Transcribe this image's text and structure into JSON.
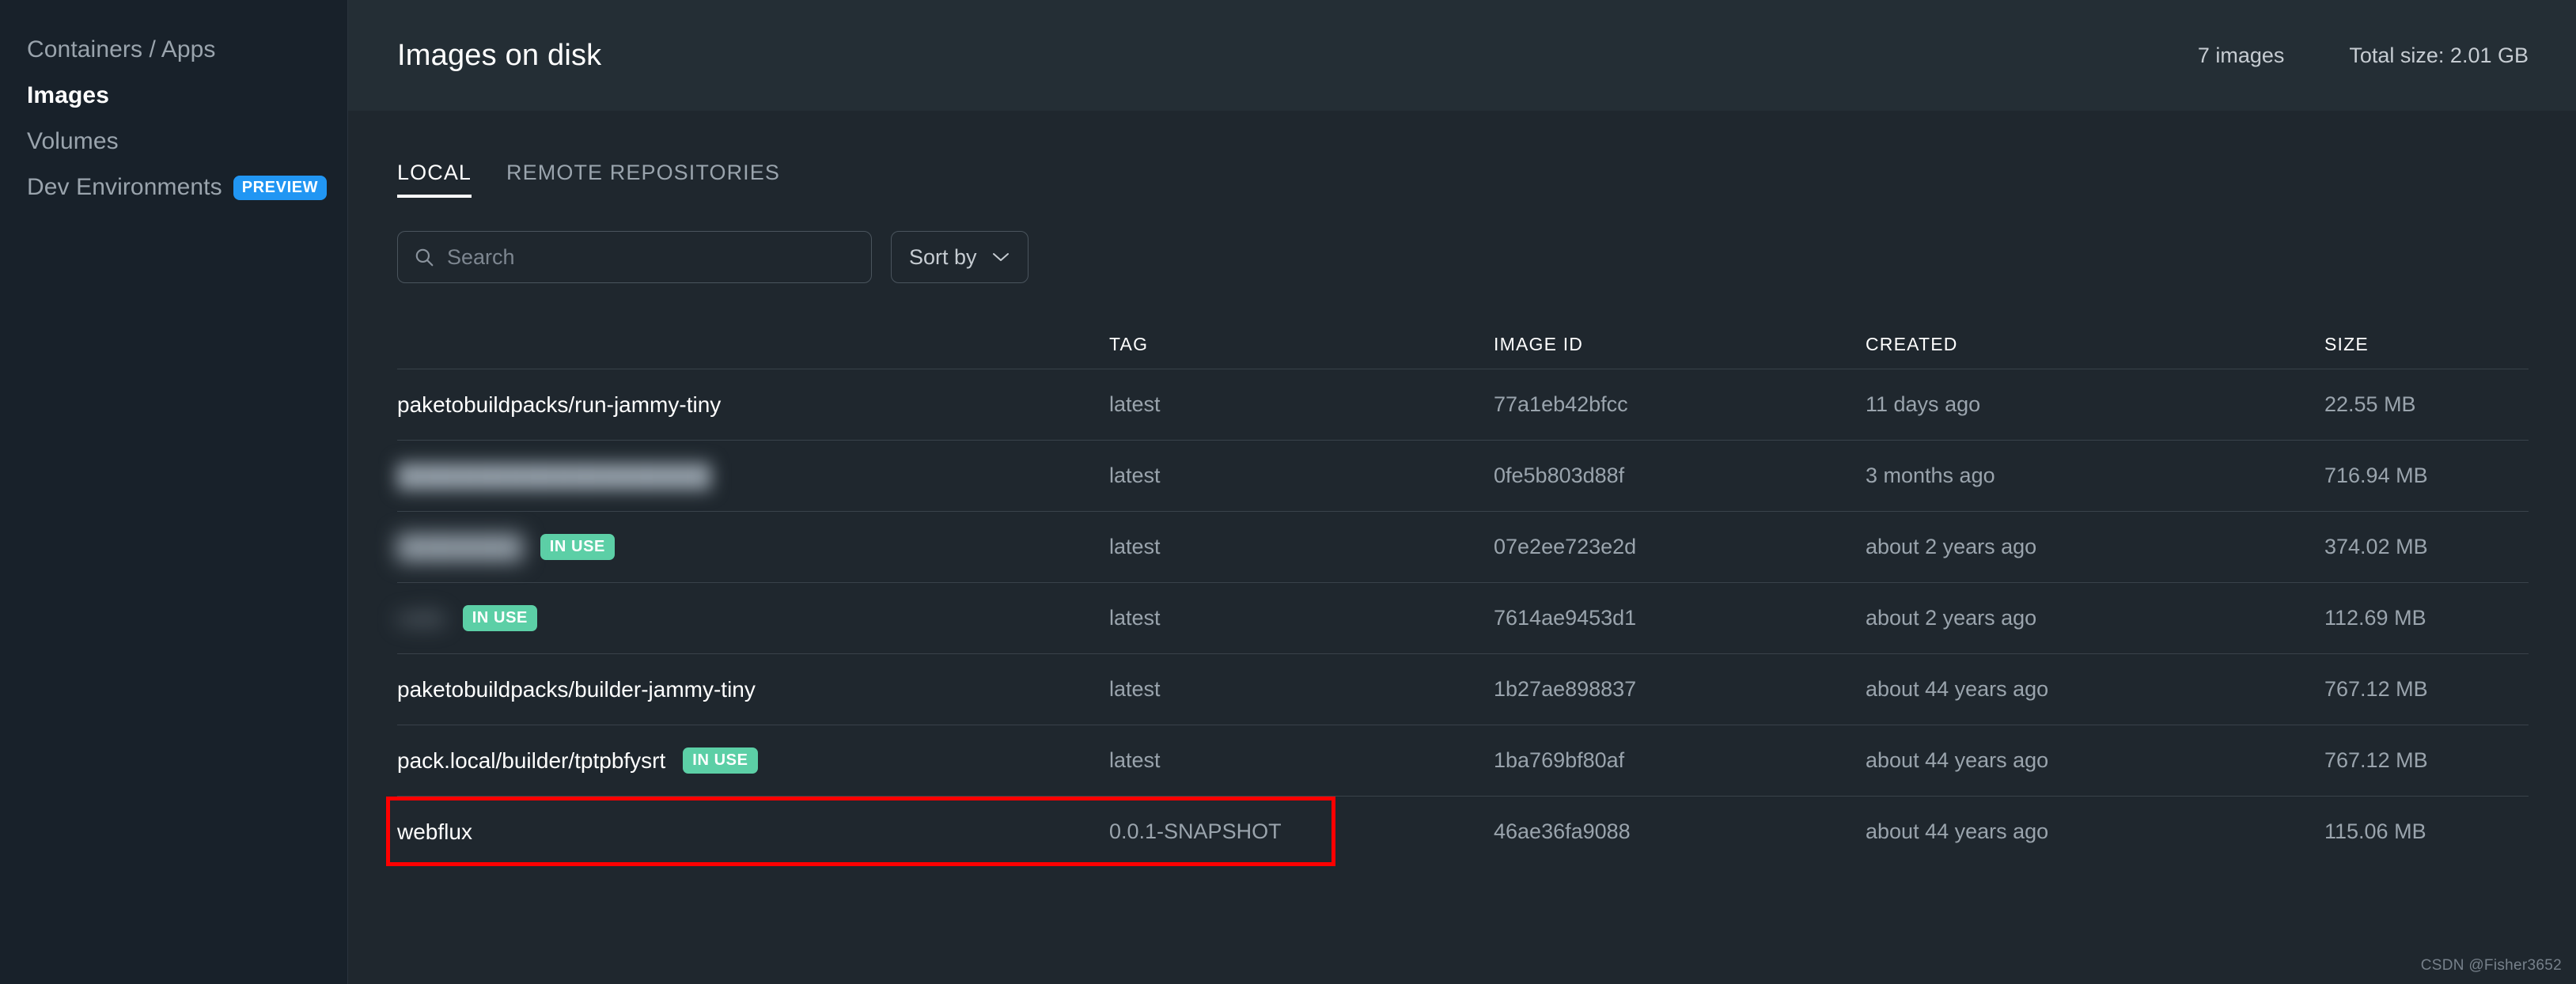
{
  "sidebar": {
    "items": [
      {
        "label": "Containers / Apps",
        "active": false,
        "badge": null
      },
      {
        "label": "Images",
        "active": true,
        "badge": null
      },
      {
        "label": "Volumes",
        "active": false,
        "badge": null
      },
      {
        "label": "Dev Environments",
        "active": false,
        "badge": "PREVIEW"
      }
    ]
  },
  "header": {
    "title": "Images on disk",
    "image_count": "7 images",
    "total_size": "Total size: 2.01 GB"
  },
  "tabs": [
    {
      "label": "LOCAL",
      "active": true
    },
    {
      "label": "REMOTE REPOSITORIES",
      "active": false
    }
  ],
  "toolbar": {
    "search_placeholder": "Search",
    "search_value": "",
    "search_icon": "search-icon",
    "sort_label": "Sort by",
    "sort_icon": "chevron-down-icon"
  },
  "table": {
    "columns": [
      "",
      "TAG",
      "IMAGE ID",
      "CREATED",
      "SIZE"
    ],
    "column_headers": {
      "name": "",
      "tag": "TAG",
      "image_id": "IMAGE ID",
      "created": "CREATED",
      "size": "SIZE"
    },
    "rows": [
      {
        "name": "paketobuildpacks/run-jammy-tiny",
        "redacted": false,
        "in_use": false,
        "in_use_label": "",
        "tag": "latest",
        "image_id": "77a1eb42bfcc",
        "created": "11 days ago",
        "size": "22.55 MB",
        "highlighted": false
      },
      {
        "name": "████████████████████",
        "redacted": true,
        "in_use": false,
        "in_use_label": "",
        "tag": "latest",
        "image_id": "0fe5b803d88f",
        "created": "3 months ago",
        "size": "716.94 MB",
        "highlighted": false
      },
      {
        "name": "████████",
        "redacted": true,
        "in_use": true,
        "in_use_label": "IN USE",
        "tag": "latest",
        "image_id": "07e2ee723e2d",
        "created": "about 2 years ago",
        "size": "374.02 MB",
        "highlighted": false
      },
      {
        "name": "redis",
        "redacted": true,
        "in_use": true,
        "in_use_label": "IN USE",
        "tag": "latest",
        "image_id": "7614ae9453d1",
        "created": "about 2 years ago",
        "size": "112.69 MB",
        "highlighted": false
      },
      {
        "name": "paketobuildpacks/builder-jammy-tiny",
        "redacted": false,
        "in_use": false,
        "in_use_label": "",
        "tag": "latest",
        "image_id": "1b27ae898837",
        "created": "about 44 years ago",
        "size": "767.12 MB",
        "highlighted": false
      },
      {
        "name": "pack.local/builder/tptpbfysrt",
        "redacted": false,
        "in_use": true,
        "in_use_label": "IN USE",
        "tag": "latest",
        "image_id": "1ba769bf80af",
        "created": "about 44 years ago",
        "size": "767.12 MB",
        "highlighted": false
      },
      {
        "name": "webflux",
        "redacted": false,
        "in_use": false,
        "in_use_label": "",
        "tag": "0.0.1-SNAPSHOT",
        "image_id": "46ae36fa9088",
        "created": "about 44 years ago",
        "size": "115.06 MB",
        "highlighted": true
      }
    ]
  },
  "watermark": "CSDN @Fisher3652",
  "colors": {
    "sidebar_bg": "#18212a",
    "content_bg": "#1f272e",
    "header_bg": "#242e35",
    "accent_preview": "#2196f3",
    "accent_in_use": "#5ccfa6",
    "highlight_border": "#ff0000",
    "text_primary": "#ffffff",
    "text_muted": "#9aa4ad"
  }
}
